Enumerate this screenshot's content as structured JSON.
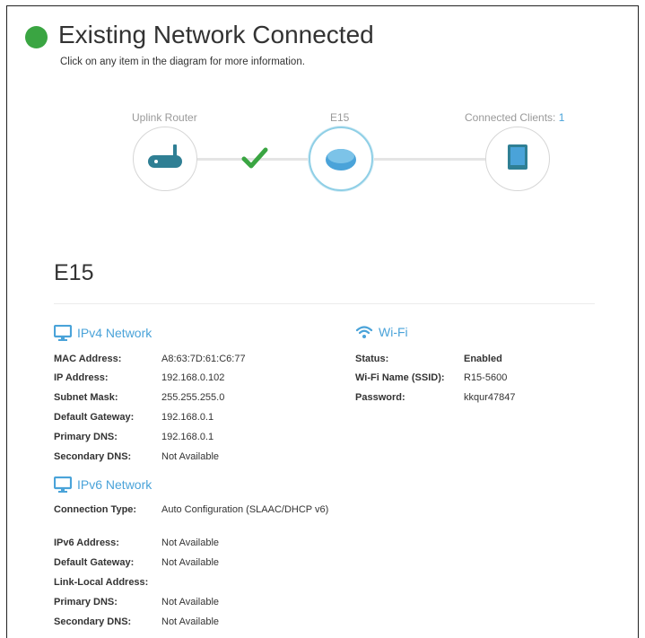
{
  "header": {
    "title": "Existing Network Connected",
    "subtitle": "Click on any item in the diagram for more information."
  },
  "diagram": {
    "uplink_label": "Uplink Router",
    "device_label": "E15",
    "clients_label": "Connected Clients: ",
    "clients_count": "1"
  },
  "device": {
    "name": "E15"
  },
  "ipv4": {
    "title": "IPv4 Network",
    "rows": [
      {
        "label": "MAC Address:",
        "value": "A8:63:7D:61:C6:77"
      },
      {
        "label": "IP Address:",
        "value": "192.168.0.102"
      },
      {
        "label": "Subnet Mask:",
        "value": "255.255.255.0"
      },
      {
        "label": "Default Gateway:",
        "value": "192.168.0.1"
      },
      {
        "label": "Primary DNS:",
        "value": "192.168.0.1"
      },
      {
        "label": "Secondary DNS:",
        "value": "Not Available"
      }
    ]
  },
  "ipv6": {
    "title": "IPv6 Network",
    "rows": [
      {
        "label": "Connection Type:",
        "value": "Auto Configuration (SLAAC/DHCP v6)"
      },
      {
        "label": "IPv6 Address:",
        "value": "Not Available"
      },
      {
        "label": "Default Gateway:",
        "value": "Not Available"
      },
      {
        "label": "Link-Local Address:",
        "value": ""
      },
      {
        "label": "Primary DNS:",
        "value": "Not Available"
      },
      {
        "label": "Secondary DNS:",
        "value": "Not Available"
      }
    ]
  },
  "wifi": {
    "title": "Wi-Fi",
    "rows": [
      {
        "label": "Status:",
        "value": "Enabled"
      },
      {
        "label": "Wi-Fi Name (SSID):",
        "value": "R15-5600"
      },
      {
        "label": "Password:",
        "value": "kkqur47847"
      }
    ]
  },
  "colors": {
    "status_green": "#3aa542",
    "accent_blue": "#4aa3d9",
    "router_teal": "#2f7f94"
  }
}
